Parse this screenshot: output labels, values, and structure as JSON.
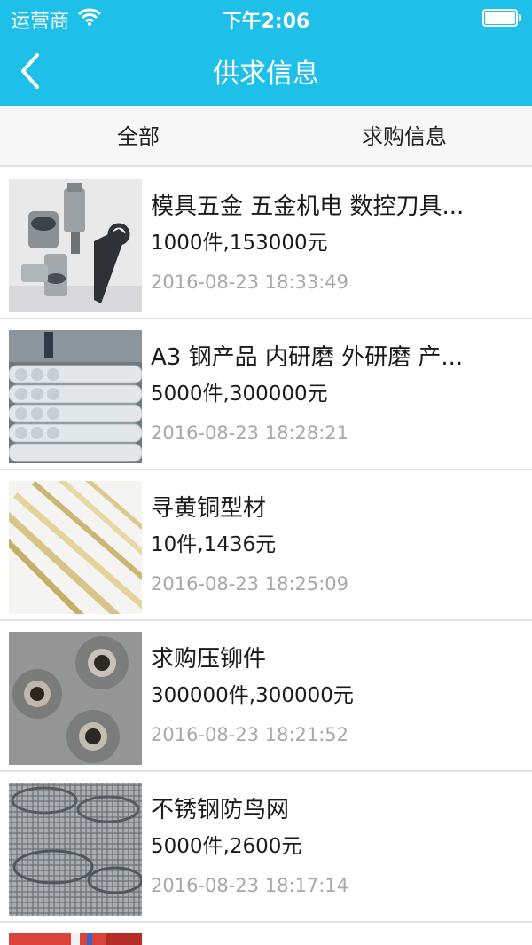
{
  "status_bar": {
    "carrier": "运营商",
    "time": "下午2:06"
  },
  "nav": {
    "title": "供求信息",
    "back_icon": "chevron-left-icon"
  },
  "tabs": [
    {
      "label": "全部"
    },
    {
      "label": "求购信息"
    }
  ],
  "items": [
    {
      "title": "模具五金 五金机电 数控刀具...",
      "price": "1000件,153000元",
      "date": "2016-08-23 18:33:49",
      "image": "tool-holders-photo"
    },
    {
      "title": "A3 钢产品 内研磨 外研磨 产...",
      "price": "5000件,300000元",
      "date": "2016-08-23 18:28:21",
      "image": "steel-pipes-photo"
    },
    {
      "title": "寻黄铜型材",
      "price": "10件,1436元",
      "date": "2016-08-23 18:25:09",
      "image": "brass-bars-photo"
    },
    {
      "title": "求购压铆件",
      "price": "300000件,300000元",
      "date": "2016-08-23 18:21:52",
      "image": "rivet-nuts-photo"
    },
    {
      "title": "不锈钢防鸟网",
      "price": "5000件,2600元",
      "date": "2016-08-23 18:17:14",
      "image": "wire-mesh-photo"
    }
  ],
  "colors": {
    "header": "#1ec0ea",
    "date_text": "#a8a8a8",
    "divider": "#e3e3e3"
  }
}
